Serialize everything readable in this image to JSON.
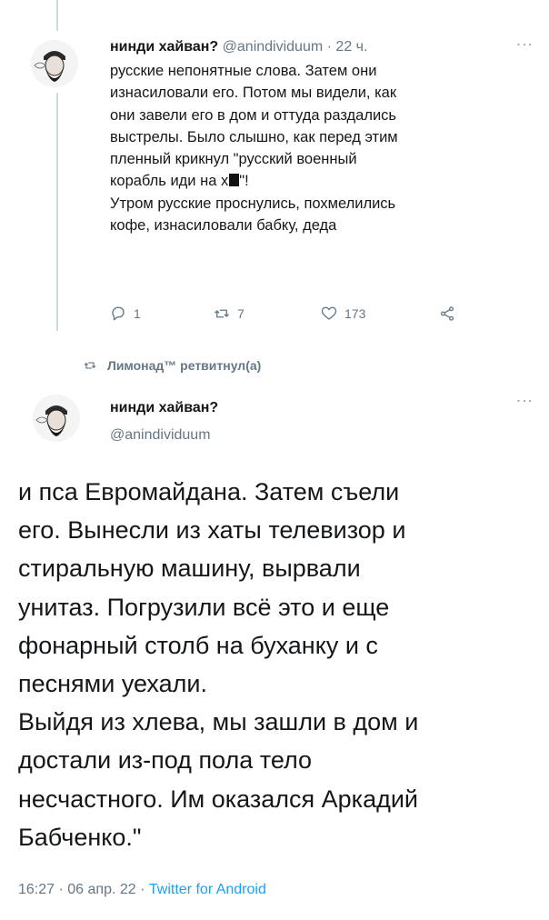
{
  "tweet1": {
    "author_name": "нинди хайван?",
    "author_handle": "@anindividuum",
    "dot": "·",
    "age": "22 ч.",
    "lines": [
      "русские непонятные слова. Затем они",
      "изнасиловали его. Потом мы видели, как",
      "они завели его в дом и оттуда раздались",
      "выстрелы. Было слышно, как перед этим",
      "пленный крикнул \"русский военный",
      "корабль иди на х",
      "\"!",
      "Утром русские проснулись, похмелились",
      "кофе, изнасиловали  бабку, деда"
    ],
    "reply_count": "1",
    "retweet_count": "7",
    "like_count": "173"
  },
  "retweet_context": {
    "text": "Лимонад™ ретвитнул(а)"
  },
  "tweet2": {
    "author_name": "нинди хайван?",
    "author_handle": "@anindividuum",
    "lines": [
      "и пса Евромайдана. Затем съели",
      "его. Вынесли из хаты телевизор и",
      "стиральную машину, вырвали",
      "унитаз. Погрузили всё это и еще",
      "фонарный столб на буханку и с",
      "песнями уехали.",
      "Выйдя из хлева, мы зашли в дом и",
      "достали из-под пола тело",
      "несчастного. Им оказался Аркадий",
      "Бабченко.\""
    ],
    "time": "16:27",
    "sep": "·",
    "date": "06 апр. 22",
    "sep2": "·",
    "source": "Twitter for Android"
  },
  "icons": {
    "reply": "reply-icon",
    "retweet": "retweet-icon",
    "like": "heart-icon",
    "share": "share-icon",
    "more": "more-icon"
  },
  "colors": {
    "text": "#14171a",
    "secondary": "#657786",
    "link": "#1da1f2",
    "thread_line": "#cfd9de"
  }
}
